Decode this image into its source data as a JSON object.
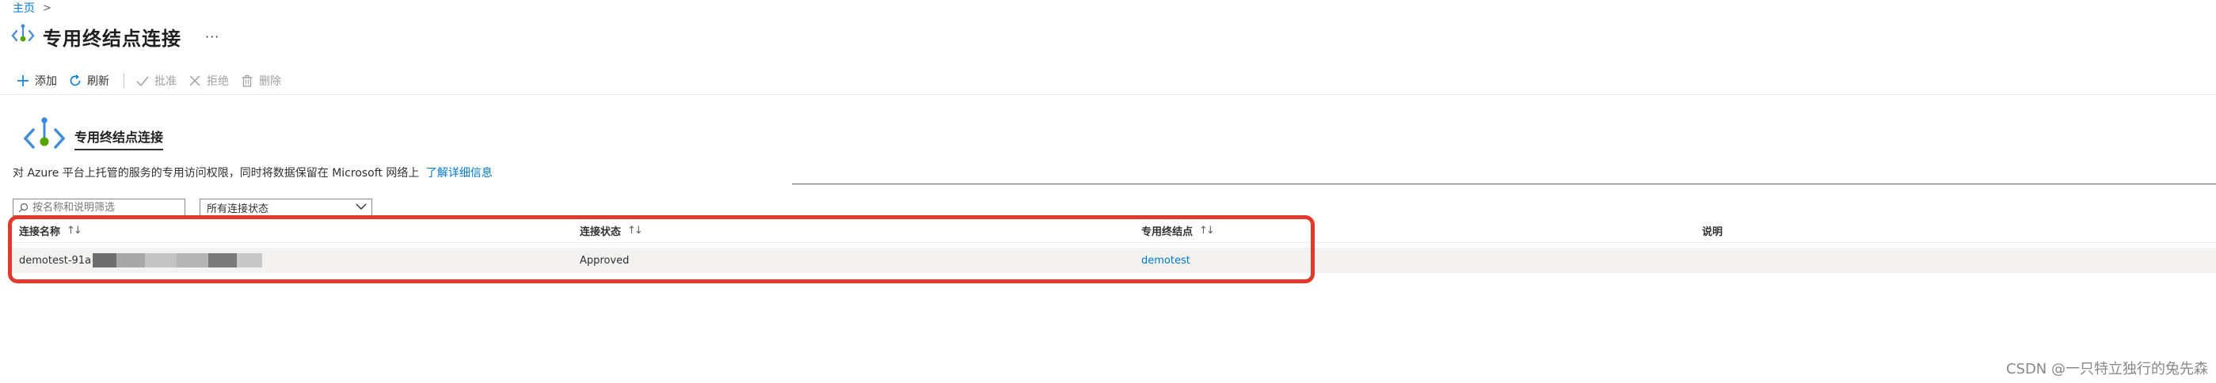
{
  "breadcrumb": {
    "home": "主页",
    "separator": ">"
  },
  "header": {
    "title": "专用终结点连接",
    "more": "···",
    "icon": "private-endpoint-icon"
  },
  "toolbar": {
    "add": "添加",
    "refresh": "刷新",
    "approve": "批准",
    "reject": "拒绝",
    "delete": "删除"
  },
  "section": {
    "title": "专用终结点连接",
    "description": "对 Azure 平台上托管的服务的专用访问权限，同时将数据保留在 Microsoft 网络上",
    "learn_more": "了解详细信息"
  },
  "filters": {
    "search_placeholder": "按名称和说明筛选",
    "status_selected": "所有连接状态"
  },
  "table": {
    "columns": [
      "连接名称",
      "连接状态",
      "专用终结点",
      "说明"
    ],
    "rows": [
      {
        "name": "demotest-91a",
        "status": "Approved",
        "endpoint": "demotest",
        "description": ""
      }
    ]
  },
  "colors": {
    "accent": "#0078d4",
    "highlight": "#e23a2a"
  },
  "watermark": "CSDN @一只特立独行的兔先森"
}
